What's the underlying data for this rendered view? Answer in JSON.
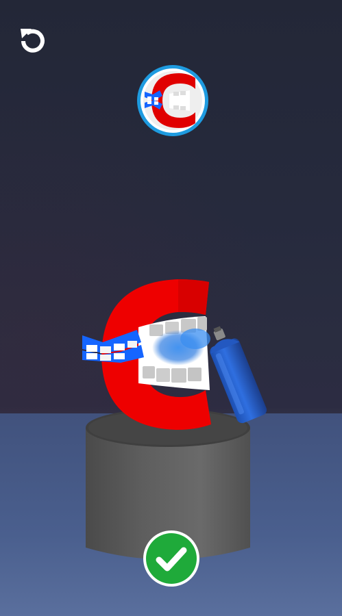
{
  "game": {
    "title": "",
    "hud": {
      "restart_icon": "restart-icon",
      "confirm_icon": "check-icon"
    },
    "target": {
      "description_icon": "target-letter-c-preview",
      "border_color": "#1e9be0",
      "letter_color": "#e00000",
      "accent_color": "#1565ff"
    },
    "scene": {
      "character_icon": "letter-c-mouth",
      "character_color": "#ee0000",
      "teeth_paint_color": "#1565ff",
      "spray_can_icon": "spray-can-icon",
      "spray_color": "#2a7be4",
      "pedestal_color": "#555555",
      "confirm_color": "#1faa3a"
    }
  }
}
